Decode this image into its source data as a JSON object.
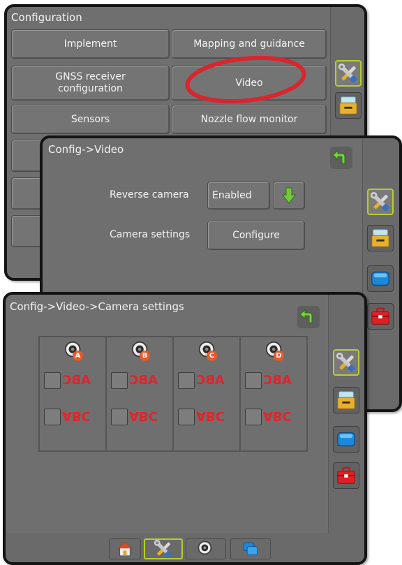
{
  "screen1": {
    "title": "Configuration",
    "buttons": {
      "implement": "Implement",
      "mapping": "Mapping and guidance",
      "gnss": "GNSS receiver configuration",
      "video": "Video",
      "sensors": "Sensors",
      "nozzle": "Nozzle flow monitor"
    },
    "highlight_color": "#d8262e"
  },
  "screen2": {
    "title": "Config->Video",
    "reverse_camera_label": "Reverse camera",
    "reverse_camera_value": "Enabled",
    "camera_settings_label": "Camera settings",
    "configure_label": "Configure"
  },
  "screen3": {
    "title": "Config->Video->Camera settings",
    "cameras": [
      {
        "badge": "A",
        "mirror_text": "ABC",
        "flip_text": "ABC"
      },
      {
        "badge": "B",
        "mirror_text": "ABC",
        "flip_text": "ABC"
      },
      {
        "badge": "C",
        "mirror_text": "ABC",
        "flip_text": "ABC"
      },
      {
        "badge": "D",
        "mirror_text": "ABC",
        "flip_text": "ABC"
      }
    ]
  },
  "icons": {
    "tools": "tools-icon",
    "console": "console-icon",
    "screen": "display-icon",
    "toolbox": "toolbox-icon",
    "back": "back-arrow-icon",
    "home": "home-icon",
    "camera": "camera-icon",
    "apps": "apps-icon"
  },
  "colors": {
    "accent_green": "#b7cf2c",
    "abc_red": "#e2232a",
    "badge_orange": "#e8592a"
  }
}
